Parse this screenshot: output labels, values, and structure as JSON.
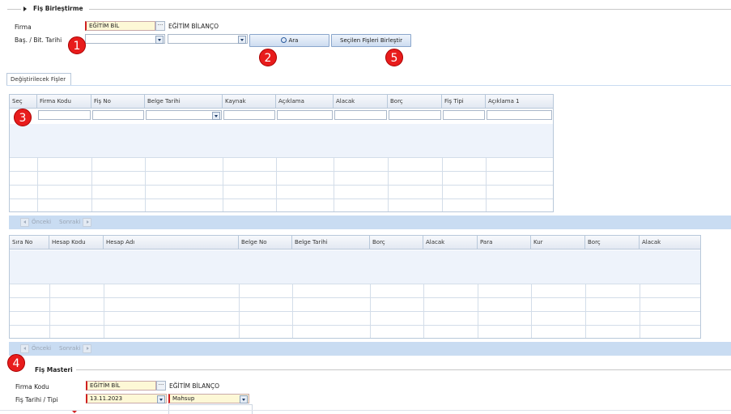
{
  "section_header": {
    "title": "Fiş Birleştirme"
  },
  "filters": {
    "firma_label": "Firma",
    "firma_code": "EĞİTİM BİL",
    "firma_name": "EĞİTİM BİLANÇO",
    "date_label": "Baş. / Bit. Tarihi",
    "start_date": "",
    "end_date": "",
    "search_button": "Ara",
    "merge_button": "Seçilen Fişleri Birleştir"
  },
  "markers": [
    "1",
    "2",
    "3",
    "4",
    "5"
  ],
  "tab": {
    "label": "Değiştirilecek Fişler"
  },
  "grid1": {
    "columns": [
      "Seç",
      "Firma Kodu",
      "Fiş No",
      "Belge Tarihi",
      "Kaynak",
      "Açıklama",
      "Alacak",
      "Borç",
      "Fiş Tipi",
      "Açıklama 1"
    ]
  },
  "grid2": {
    "columns": [
      "Sıra No",
      "Hesap Kodu",
      "Hesap Adı",
      "Belge No",
      "Belge Tarihi",
      "Borç",
      "Alacak",
      "Para",
      "Kur",
      "Borç",
      "Alacak"
    ]
  },
  "pager": {
    "prev": "Önceki",
    "next": "Sonraki"
  },
  "master": {
    "title": "Fiş Masteri",
    "firma_kodu_label": "Firma Kodu",
    "firma_code": "EĞİTİM BİL",
    "firma_name": "EĞİTİM BİLANÇO",
    "date_type_label": "Fiş Tarihi / Tipi",
    "date": "13.11.2023",
    "type": "Mahsup"
  },
  "colors": {
    "accent": "#c9dcf2",
    "marker": "#e81c1c",
    "required": "#d02020"
  }
}
